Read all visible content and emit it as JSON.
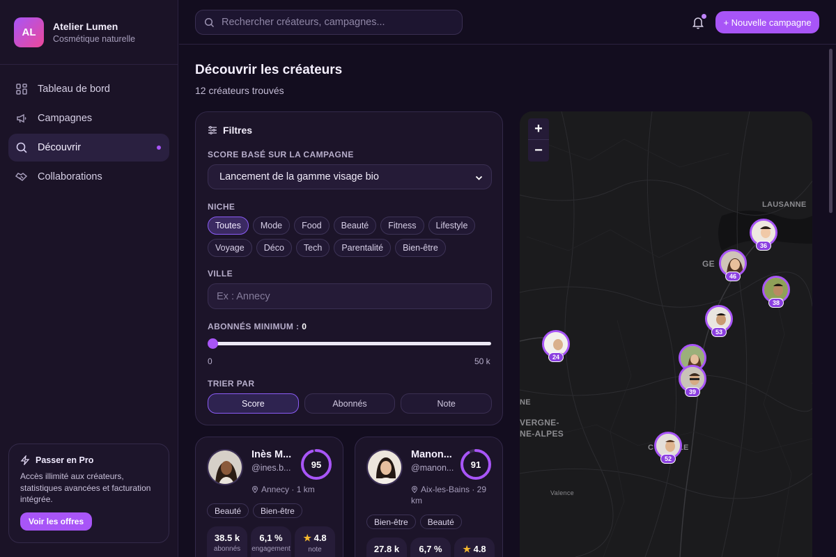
{
  "brand": {
    "initials": "AL",
    "name": "Atelier Lumen",
    "subtitle": "Cosmétique naturelle"
  },
  "nav": [
    {
      "label": "Tableau de bord",
      "icon": "dashboard-icon",
      "active": false
    },
    {
      "label": "Campagnes",
      "icon": "megaphone-icon",
      "active": false
    },
    {
      "label": "Découvrir",
      "icon": "search-icon",
      "active": true
    },
    {
      "label": "Collaborations",
      "icon": "handshake-icon",
      "active": false
    }
  ],
  "pro": {
    "title": "Passer en Pro",
    "text": "Accès illimité aux créateurs, statistiques avancées et facturation intégrée.",
    "button": "Voir les offres"
  },
  "topbar": {
    "search_placeholder": "Rechercher créateurs, campagnes...",
    "new_campaign": "+ Nouvelle campagne"
  },
  "page": {
    "title": "Découvrir les créateurs",
    "subtitle": "12 créateurs trouvés"
  },
  "filters": {
    "title": "Filtres",
    "campaign_label": "SCORE BASÉ SUR LA CAMPAGNE",
    "campaign_value": "Lancement de la gamme visage bio",
    "niche_label": "NICHE",
    "niches_row1": [
      "Toutes",
      "Mode",
      "Food",
      "Beauté",
      "Fitness",
      "Lifestyle"
    ],
    "niches_row2": [
      "Voyage",
      "Déco",
      "Tech",
      "Parentalité",
      "Bien-être"
    ],
    "active_niche": "Toutes",
    "city_label": "VILLE",
    "city_placeholder": "Ex : Annecy",
    "followers_label": "ABONNÉS MINIMUM : ",
    "followers_value": "0",
    "followers_fraction": 0,
    "range_min": "0",
    "range_max": "50 k",
    "sort_label": "TRIER PAR",
    "sort_options": [
      "Score",
      "Abonnés",
      "Note"
    ],
    "sort_active": "Score"
  },
  "creators": [
    {
      "name": "Inès M...",
      "handle": "@ines.b...",
      "score": "95",
      "score_fraction": 0.95,
      "location": "Annecy · 1 km",
      "tags": [
        "Beauté",
        "Bien-être"
      ],
      "followers": "38.5 k",
      "followers_label": "abonnés",
      "engagement": "6,1 %",
      "engagement_label": "engagement",
      "rating": "4.8",
      "rating_label": "note"
    },
    {
      "name": "Manon...",
      "handle": "@manon...",
      "score": "91",
      "score_fraction": 0.91,
      "location": "Aix-les-Bains · 29 km",
      "tags": [
        "Bien-être",
        "Beauté"
      ],
      "followers": "27.8 k",
      "followers_label": "",
      "engagement": "6,7 %",
      "engagement_label": "",
      "rating": "4.8",
      "rating_label": ""
    }
  ],
  "map": {
    "zoom_in": "+",
    "zoom_out": "−",
    "labels": [
      "LAUSANNE",
      "GE",
      "NE",
      "VERGNE-",
      "NE-ALPES",
      "C",
      "LE",
      "Valence"
    ],
    "pins": [
      "36",
      "46",
      "38",
      "53",
      "24",
      "",
      "39",
      "52"
    ]
  },
  "colors": {
    "accent": "#a855f7",
    "background": "#130d1f",
    "panel": "#1c1429"
  }
}
